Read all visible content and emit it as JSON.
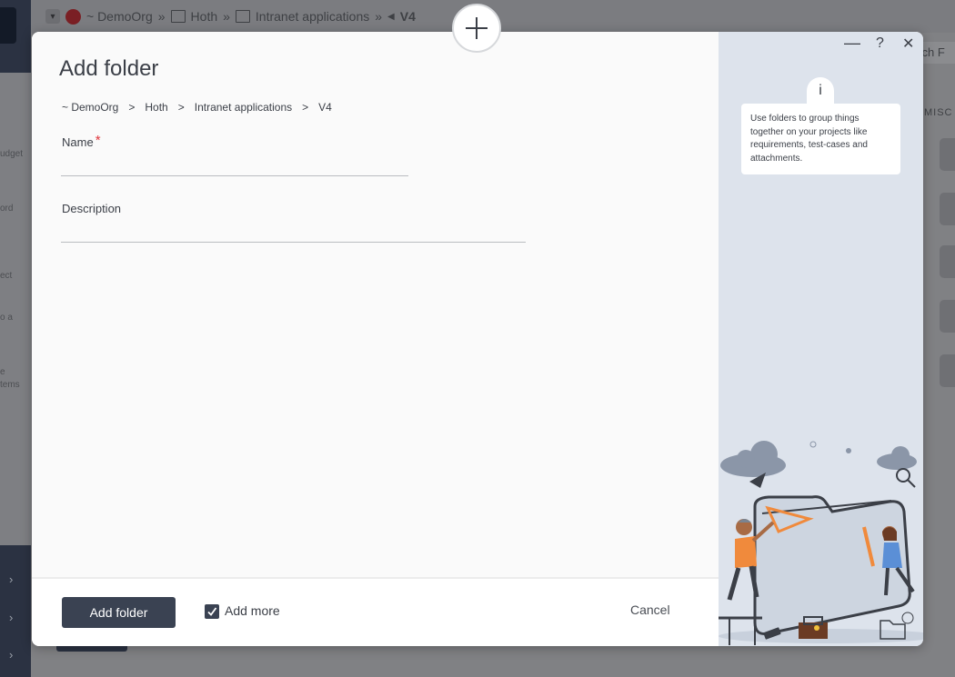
{
  "background": {
    "breadcrumb": [
      {
        "label": "~ DemoOrg"
      },
      {
        "label": "Hoth"
      },
      {
        "label": "Intranet applications"
      },
      {
        "label": "V4"
      }
    ],
    "breadcrumb_sep": "»",
    "search_placeholder": "arch F",
    "misc_label": "MISC",
    "left_texts": [
      "udget",
      "ord",
      "ect",
      "o a",
      "e",
      "tems"
    ]
  },
  "modal": {
    "title": "Add folder",
    "breadcrumb": [
      "~ DemoOrg",
      "Hoth",
      "Intranet applications",
      "V4"
    ],
    "breadcrumb_sep": ">",
    "fields": {
      "name": {
        "label": "Name",
        "required_mark": "*",
        "value": ""
      },
      "description": {
        "label": "Description",
        "value": ""
      }
    },
    "footer": {
      "submit_label": "Add folder",
      "add_more_label": "Add more",
      "add_more_checked": true,
      "cancel_label": "Cancel"
    },
    "window_controls": {
      "minimize": "—",
      "help": "?",
      "close": "✕"
    },
    "info": {
      "icon_letter": "i",
      "text": "Use folders to group things together on your projects like requirements, test-cases and attachments."
    }
  },
  "colors": {
    "primary": "#3a4252",
    "required": "#e0383e",
    "side_panel": "#dde3ec",
    "accent_orange": "#f08a3c",
    "accent_blue": "#5b8fd6"
  },
  "icons": [
    "plus-icon",
    "minimize-icon",
    "help-icon",
    "close-icon",
    "info-icon",
    "check-icon",
    "org-avatar-icon",
    "book-icon"
  ]
}
